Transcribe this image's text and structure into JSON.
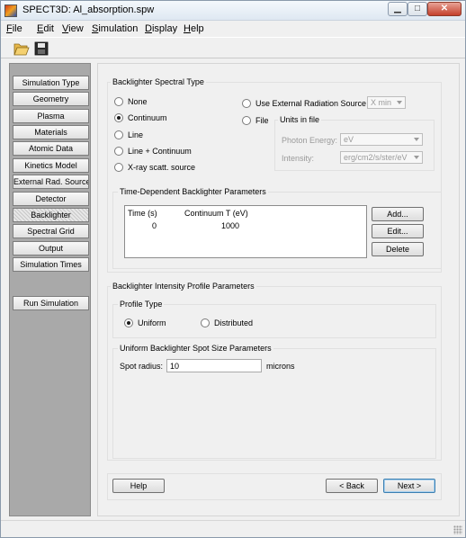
{
  "window": {
    "app_name": "SPECT3D:",
    "file_name": "Al_absorption.spw",
    "min_icon": "minimize-icon",
    "max_icon": "maximize-icon",
    "close_icon": "close-icon",
    "min_glyph": "▁",
    "max_glyph": "□",
    "close_glyph": "✕"
  },
  "menu": [
    {
      "label": "File",
      "underline": "F",
      "rest": "ile"
    },
    {
      "label": "Edit",
      "underline": "E",
      "rest": "dit"
    },
    {
      "label": "View",
      "underline": "V",
      "rest": "iew"
    },
    {
      "label": "Simulation",
      "underline": "S",
      "rest": "imulation"
    },
    {
      "label": "Display",
      "underline": "D",
      "rest": "isplay"
    },
    {
      "label": "Help",
      "underline": "H",
      "rest": "elp"
    }
  ],
  "toolbar": {
    "open_icon": "folder-open-icon",
    "save_icon": "save-disk-icon"
  },
  "sidebar": {
    "items": [
      {
        "label": "Simulation Type"
      },
      {
        "label": "Geometry"
      },
      {
        "label": "Plasma"
      },
      {
        "label": "Materials"
      },
      {
        "label": "Atomic Data"
      },
      {
        "label": "Kinetics Model"
      },
      {
        "label": "External Rad. Source"
      },
      {
        "label": "Detector"
      },
      {
        "label": "Backlighter",
        "selected": true
      },
      {
        "label": "Spectral Grid"
      },
      {
        "label": "Output"
      },
      {
        "label": "Simulation Times"
      }
    ],
    "run": "Run Simulation"
  },
  "spectral": {
    "title": "Backlighter Spectral Type",
    "options": [
      "None",
      "Continuum",
      "Line",
      "Line + Continuum",
      "X-ray scatt. source"
    ],
    "selected": "Continuum",
    "use_external": "Use External Radiation Source",
    "external_select": "X min",
    "file": "File",
    "units_title": "Units in file",
    "photon_label": "Photon Energy:",
    "photon_value": "eV",
    "intensity_label": "Intensity:",
    "intensity_value": "erg/cm2/s/ster/eV"
  },
  "time_dependent": {
    "title": "Time-Dependent Backlighter Parameters",
    "columns": [
      "Time (s)",
      "Continuum T (eV)"
    ],
    "rows": [
      [
        "0",
        "1000"
      ]
    ],
    "add": "Add...",
    "edit": "Edit...",
    "delete": "Delete"
  },
  "intensity_profile": {
    "title": "Backlighter Intensity Profile Parameters",
    "profile_title": "Profile Type",
    "uniform": "Uniform",
    "distributed": "Distributed",
    "selected": "Uniform",
    "spot_title": "Uniform Backlighter Spot Size Parameters",
    "spot_label": "Spot radius:",
    "spot_value": "10",
    "spot_unit": "microns"
  },
  "footer": {
    "help": "Help",
    "back": "< Back",
    "next": "Next >"
  },
  "colors": {
    "sidebar_bg": "#a9a9a9",
    "panel_bg": "#f0f0f0",
    "default_button_border": "#3c7fb1"
  }
}
